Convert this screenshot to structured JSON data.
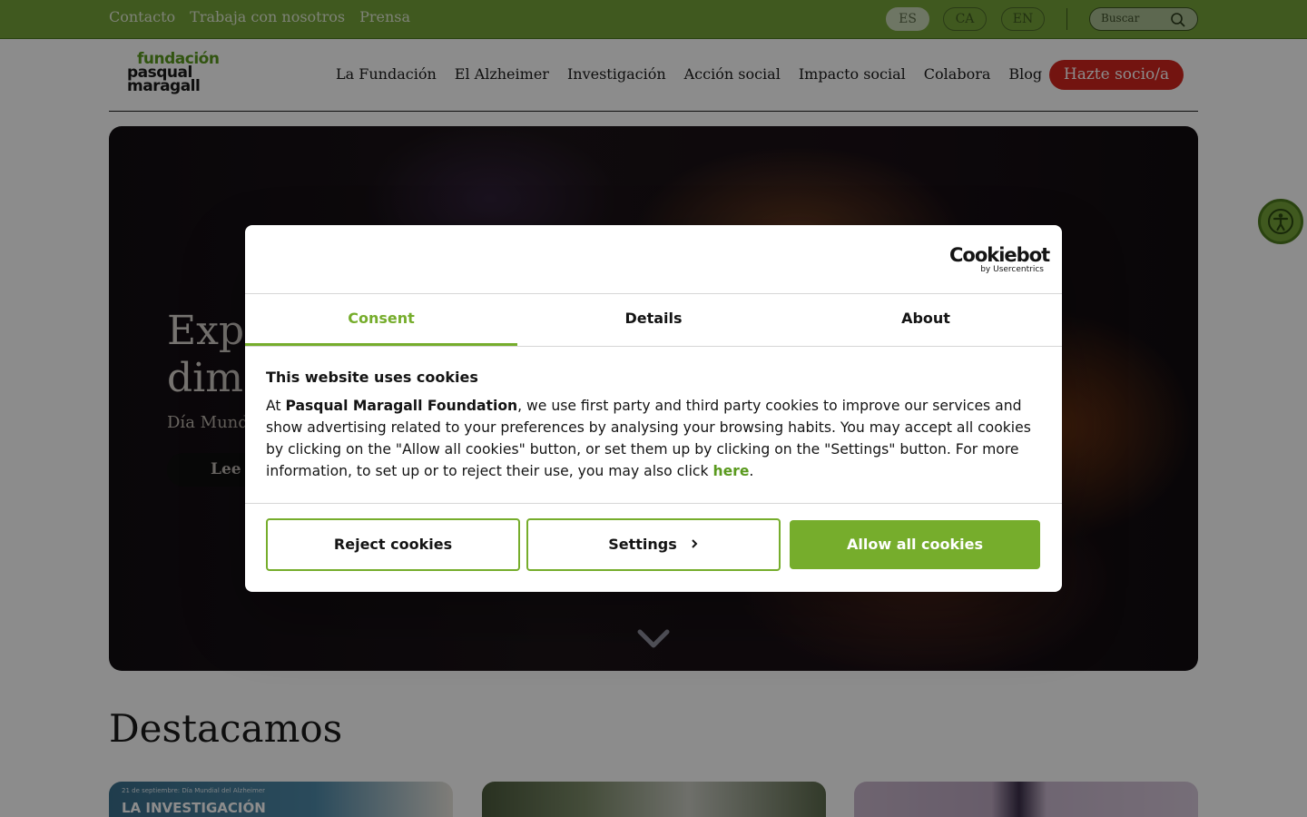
{
  "topbar": {
    "links": [
      "Contacto",
      "Trabaja con nosotros",
      "Prensa"
    ],
    "languages": [
      "ES",
      "CA",
      "EN"
    ],
    "active_language": "ES",
    "search_placeholder": "Buscar"
  },
  "header": {
    "logo": [
      "fundación",
      "pasqual",
      "maragall"
    ],
    "nav": [
      "La Fundación",
      "El Alzheimer",
      "Investigación",
      "Acción social",
      "Impacto social",
      "Colabora",
      "Blog"
    ],
    "cta": "Hazte socio/a"
  },
  "hero": {
    "title_line1": "Expl",
    "title_line2": "dime",
    "subtitle": "Día Mund",
    "button": "Lee r"
  },
  "featured": {
    "title": "Destacamos",
    "card1_small": "21 de septiembre: Día Mundial del Alzheimer",
    "card1_big": "LA INVESTIGACIÓN"
  },
  "cookie_dialog": {
    "brand": "Cookiebot",
    "brand_sub": "by Usercentrics",
    "tabs": [
      "Consent",
      "Details",
      "About"
    ],
    "active_tab": "Consent",
    "heading": "This website uses cookies",
    "text_before": "At ",
    "text_bold": "Pasqual Maragall Foundation",
    "text_after": ", we use first party and third party cookies to improve our services and show advertising related to your preferences by analysing your browsing habits. You may accept all cookies by clicking on the \"Allow all cookies\" button, or set them up by clicking on the \"Settings\" button. For more information, to set up or to reject their use, you may also click ",
    "link_text": "here",
    "text_end": ".",
    "buttons": {
      "reject": "Reject cookies",
      "settings": "Settings",
      "allow": "Allow all cookies"
    }
  },
  "colors": {
    "topbar_green": "#76a33a",
    "cookie_green": "#76ad2c",
    "cta_red": "#d2261e"
  },
  "icons": [
    "search-icon",
    "accessibility-icon",
    "chevron-down-icon",
    "chevron-right-icon"
  ]
}
